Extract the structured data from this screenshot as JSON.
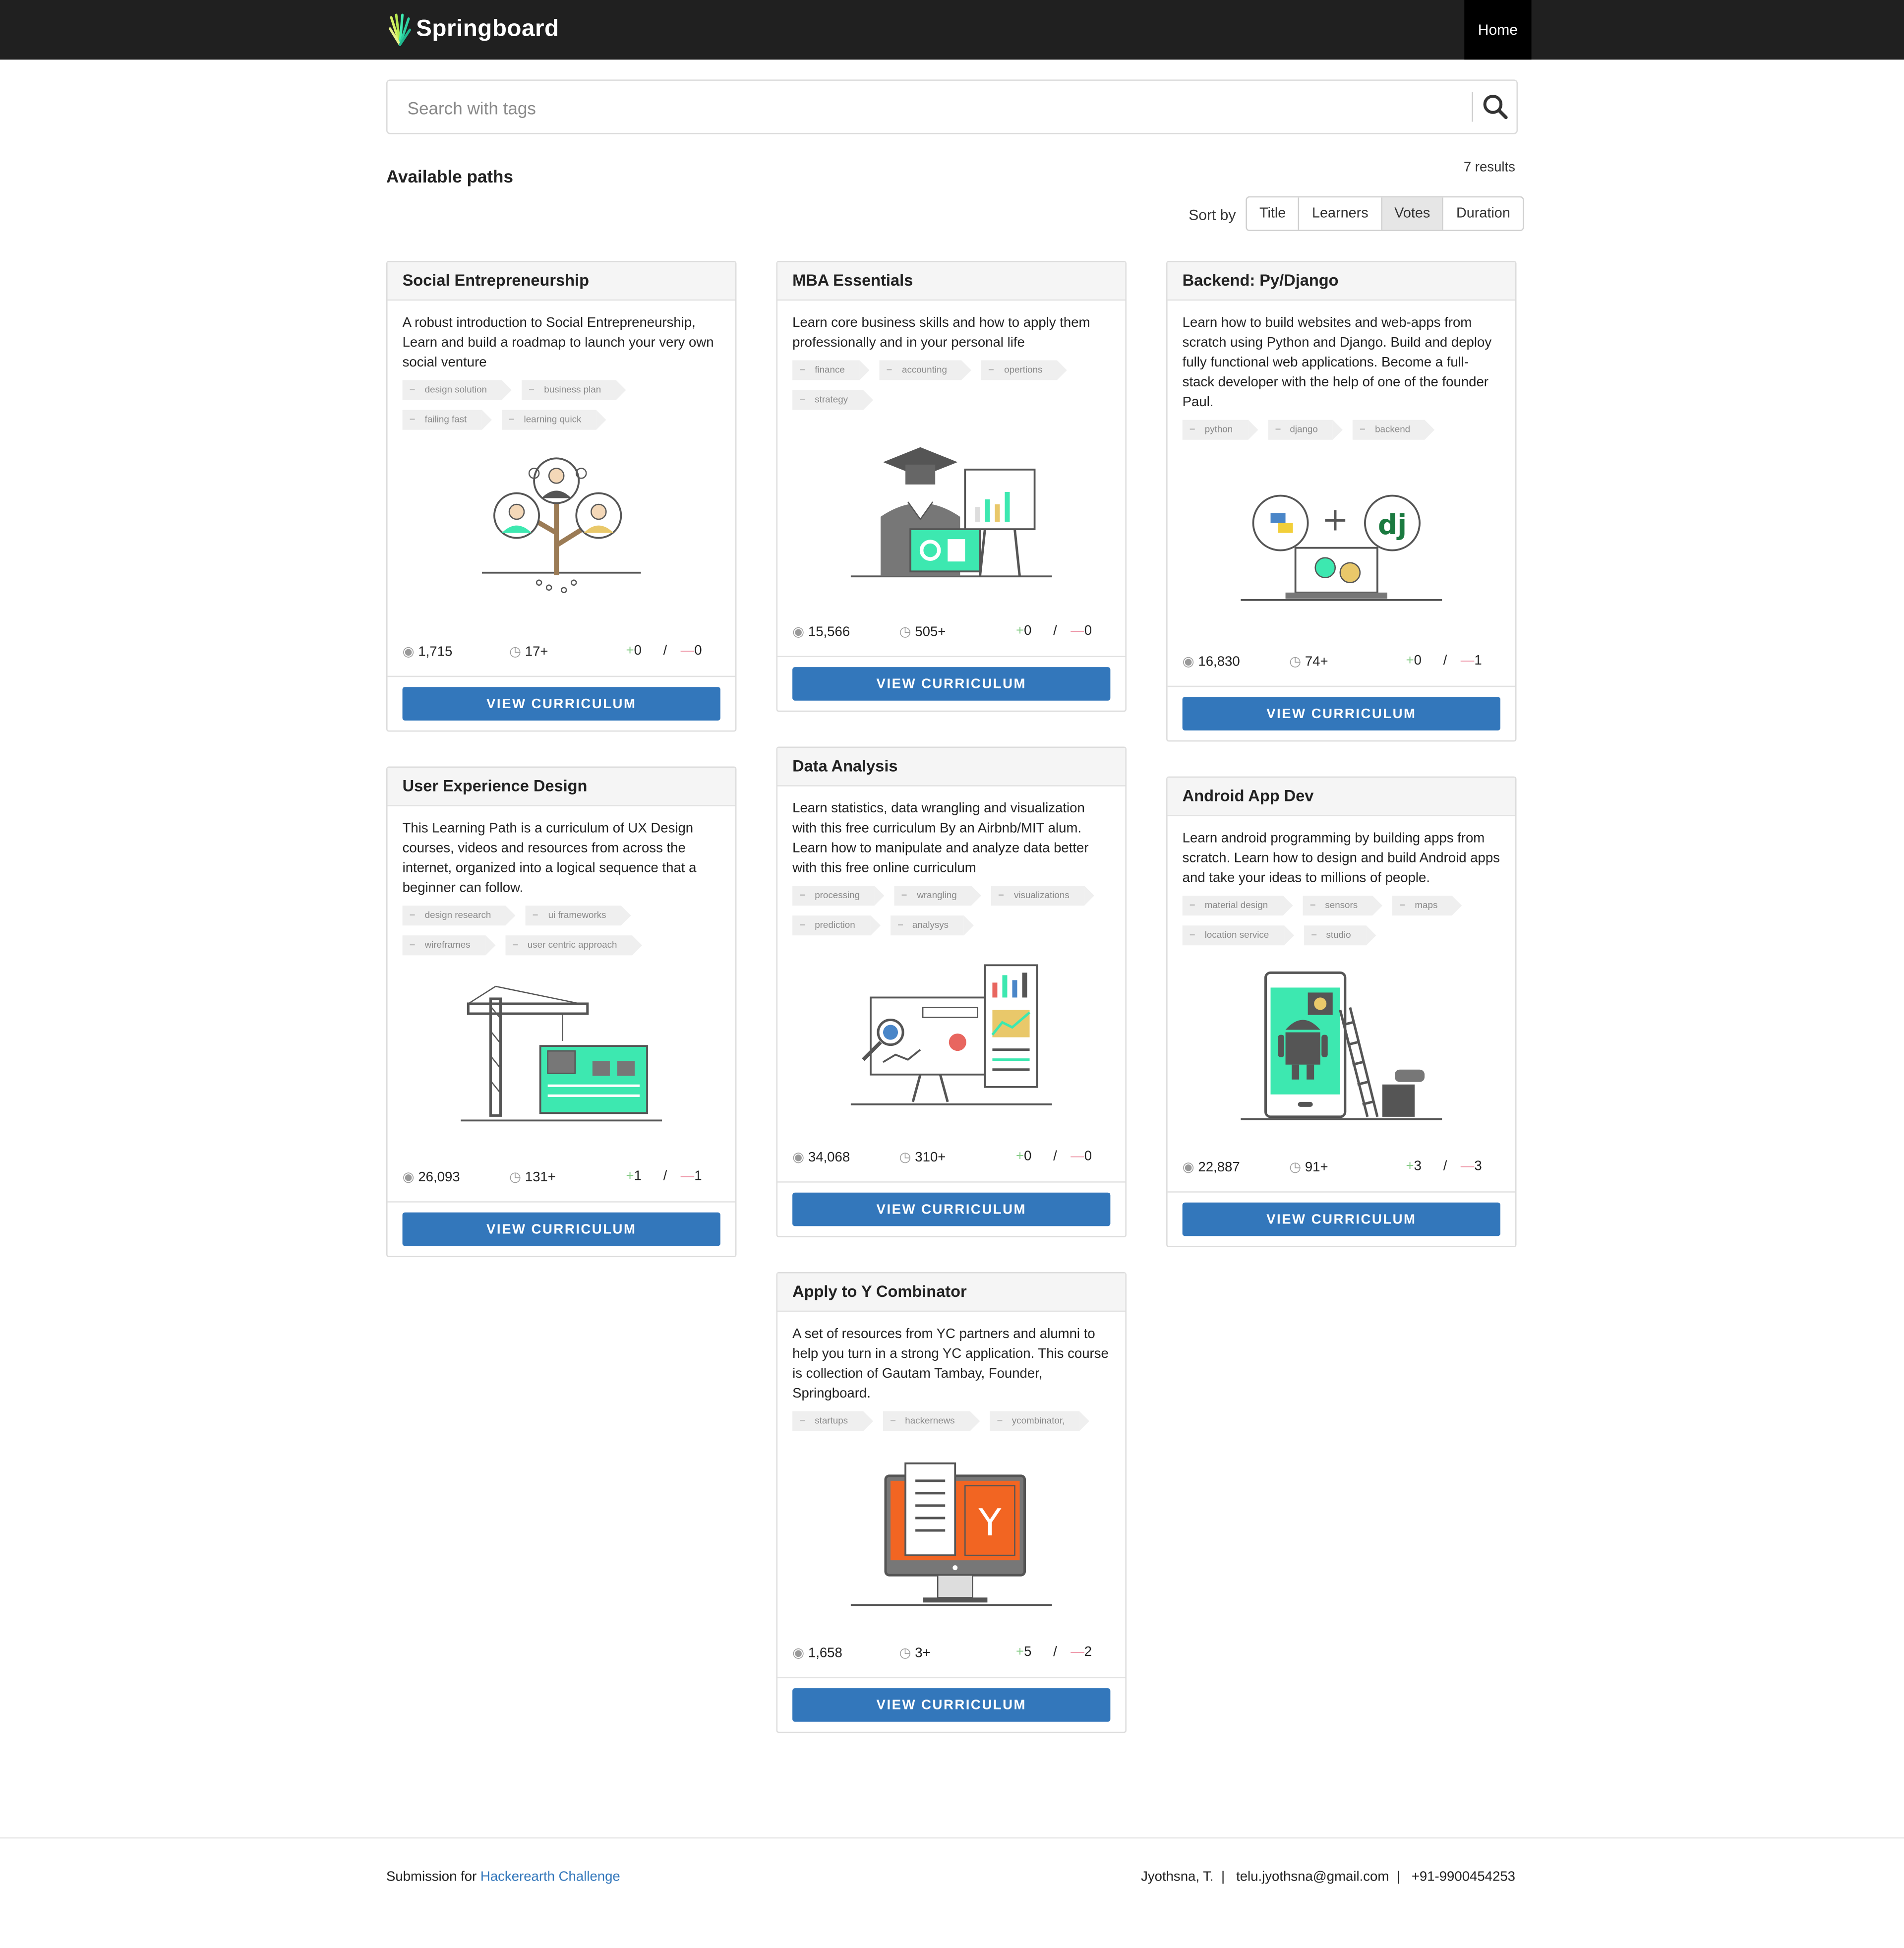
{
  "header": {
    "brand": "Springboard",
    "nav_home": "Home"
  },
  "search": {
    "placeholder": "Search with tags"
  },
  "listing": {
    "heading": "Available paths",
    "results": "7 results",
    "sort_label": "Sort by",
    "sort_options": [
      "Title",
      "Learners",
      "Votes",
      "Duration"
    ],
    "sort_active": "Votes"
  },
  "cards": [
    {
      "title": "Social Entrepreneurship",
      "description": "A robust introduction to Social Entrepreneurship, Learn and build a roadmap to launch your very own social venture",
      "tags": [
        "design solution",
        "business plan",
        "failing fast",
        "learning quick"
      ],
      "learners": "1,715",
      "duration": "17+",
      "upvotes": "0",
      "downvotes": "0",
      "cta": "VIEW CURRICULUM",
      "illustration": "tree-people-icon"
    },
    {
      "title": "MBA Essentials",
      "description": "Learn core business skills and how to apply them professionally and in your personal life",
      "tags": [
        "finance",
        "accounting",
        "opertions",
        "strategy"
      ],
      "learners": "15,566",
      "duration": "505+",
      "upvotes": "0",
      "downvotes": "0",
      "cta": "VIEW CURRICULUM",
      "illustration": "graduate-presentation-icon"
    },
    {
      "title": "Backend: Py/Django",
      "description": "Learn how to build websites and web-apps from scratch using Python and Django. Build and deploy fully functional web applications. Become a full-stack developer with the help of one of the founder Paul.",
      "tags": [
        "python",
        "django",
        "backend"
      ],
      "learners": "16,830",
      "duration": "74+",
      "upvotes": "0",
      "downvotes": "1",
      "cta": "VIEW CURRICULUM",
      "illustration": "python-django-laptop-icon"
    },
    {
      "title": "User Experience Design",
      "description": "This Learning Path is a curriculum of UX Design courses, videos and resources from across the internet, organized into a logical sequence that a beginner can follow.",
      "tags": [
        "design research",
        "ui frameworks",
        "wireframes",
        "user centric approach"
      ],
      "learners": "26,093",
      "duration": "131+",
      "upvotes": "1",
      "downvotes": "1",
      "cta": "VIEW CURRICULUM",
      "illustration": "crane-wireframe-icon"
    },
    {
      "title": "Data Analysis",
      "description": "Learn statistics, data wrangling and visualization with this free curriculum By an Airbnb/MIT alum. Learn how to manipulate and analyze data better with this free online curriculum",
      "tags": [
        "processing",
        "wrangling",
        "visualizations",
        "prediction",
        "analysys"
      ],
      "learners": "34,068",
      "duration": "310+",
      "upvotes": "0",
      "downvotes": "0",
      "cta": "VIEW CURRICULUM",
      "illustration": "data-charts-board-icon"
    },
    {
      "title": "Android App Dev",
      "description": "Learn android programming by building apps from scratch. Learn how to design and build Android apps and take your ideas to millions of people.",
      "tags": [
        "material design",
        "sensors",
        "maps",
        "location service",
        "studio"
      ],
      "learners": "22,887",
      "duration": "91+",
      "upvotes": "3",
      "downvotes": "3",
      "cta": "VIEW CURRICULUM",
      "illustration": "android-phone-ladder-icon"
    },
    {
      "title": "Apply to Y Combinator",
      "description": "A set of resources from YC partners and alumni to help you turn in a strong YC application. This course is collection of Gautam Tambay, Founder, Springboard.",
      "tags": [
        "startups",
        "hackernews",
        "ycombinator,"
      ],
      "learners": "1,658",
      "duration": "3+",
      "upvotes": "5",
      "downvotes": "2",
      "cta": "VIEW CURRICULUM",
      "illustration": "ycombinator-monitor-icon"
    }
  ],
  "footer": {
    "prefix": "Submission for ",
    "link": "Hackerearth Challenge",
    "name": "Jyothsna, T.",
    "email": "telu.jyothsna@gmail.com",
    "phone": "+91-9900454253",
    "separator": "|"
  },
  "colors": {
    "topbar": "#202020",
    "cta": "#3377bb",
    "accent_green": "#3de8b0",
    "yc_orange": "#f26522"
  }
}
